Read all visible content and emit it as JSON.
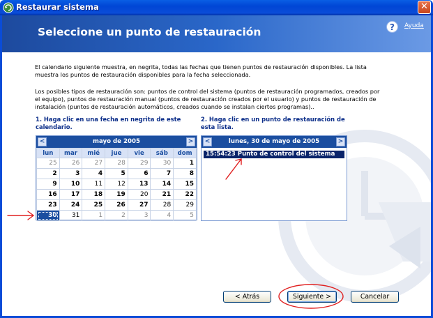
{
  "window": {
    "title": "Restaurar sistema",
    "close_glyph": "✕"
  },
  "header": {
    "title": "Seleccione un punto de restauración",
    "help_label": "Ayuda",
    "help_glyph": "?"
  },
  "content": {
    "paragraph1": "El calendario siguiente muestra, en negrita, todas las fechas que tienen puntos de restauración disponibles. La lista muestra los puntos de restauración disponibles para la fecha seleccionada.",
    "paragraph2": "Los posibles tipos de restauración son: puntos de control del sistema (puntos de restauración programados, creados por el equipo), puntos de restauración manual (puntos de restauración creados por el usuario) y puntos de restauración de instalación (puntos de restauración automáticos, creados cuando se instalan ciertos programas)..",
    "step1": "1. Haga clic en una fecha en negrita de este calendario.",
    "step2": "2. Haga clic en un punto de restauración de esta lista."
  },
  "calendar": {
    "month_label": "mayo de 2005",
    "prev_glyph": "<",
    "next_glyph": ">",
    "weekdays": [
      "lun",
      "mar",
      "mié",
      "jue",
      "vie",
      "sáb",
      "dom"
    ],
    "weeks": [
      [
        {
          "d": "25",
          "t": "other"
        },
        {
          "d": "26",
          "t": "other"
        },
        {
          "d": "27",
          "t": "other"
        },
        {
          "d": "28",
          "t": "other"
        },
        {
          "d": "29",
          "t": "other"
        },
        {
          "d": "30",
          "t": "other"
        },
        {
          "d": "1",
          "t": "bold"
        }
      ],
      [
        {
          "d": "2",
          "t": "bold"
        },
        {
          "d": "3",
          "t": "bold"
        },
        {
          "d": "4",
          "t": "bold"
        },
        {
          "d": "5",
          "t": "bold"
        },
        {
          "d": "6",
          "t": "bold"
        },
        {
          "d": "7",
          "t": "bold"
        },
        {
          "d": "8",
          "t": "bold"
        }
      ],
      [
        {
          "d": "9",
          "t": "bold"
        },
        {
          "d": "10",
          "t": "bold"
        },
        {
          "d": "11",
          "t": "plain"
        },
        {
          "d": "12",
          "t": "plain"
        },
        {
          "d": "13",
          "t": "bold"
        },
        {
          "d": "14",
          "t": "bold"
        },
        {
          "d": "15",
          "t": "bold"
        }
      ],
      [
        {
          "d": "16",
          "t": "bold"
        },
        {
          "d": "17",
          "t": "bold"
        },
        {
          "d": "18",
          "t": "bold"
        },
        {
          "d": "19",
          "t": "bold"
        },
        {
          "d": "20",
          "t": "plain"
        },
        {
          "d": "21",
          "t": "bold"
        },
        {
          "d": "22",
          "t": "bold"
        }
      ],
      [
        {
          "d": "23",
          "t": "bold"
        },
        {
          "d": "24",
          "t": "bold"
        },
        {
          "d": "25",
          "t": "bold"
        },
        {
          "d": "26",
          "t": "bold"
        },
        {
          "d": "27",
          "t": "bold"
        },
        {
          "d": "28",
          "t": "plain"
        },
        {
          "d": "29",
          "t": "plain"
        }
      ],
      [
        {
          "d": "30",
          "t": "sel"
        },
        {
          "d": "31",
          "t": "plain"
        },
        {
          "d": "1",
          "t": "other"
        },
        {
          "d": "2",
          "t": "other"
        },
        {
          "d": "3",
          "t": "other"
        },
        {
          "d": "4",
          "t": "other"
        },
        {
          "d": "5",
          "t": "other"
        }
      ]
    ]
  },
  "restore_list": {
    "date_label": "lunes, 30 de mayo de 2005",
    "prev_glyph": "<",
    "next_glyph": ">",
    "items": [
      {
        "time": "15:54:23",
        "description": "Punto de control del sistema"
      }
    ]
  },
  "buttons": {
    "back": "< Atrás",
    "next": "Siguiente >",
    "cancel": "Cancelar"
  },
  "colors": {
    "titlebar": "#0046d5",
    "header": "#2a67c9",
    "calendar_header": "#1b4ea0",
    "selection": "#0a246a",
    "annotation_red": "#e02020"
  }
}
